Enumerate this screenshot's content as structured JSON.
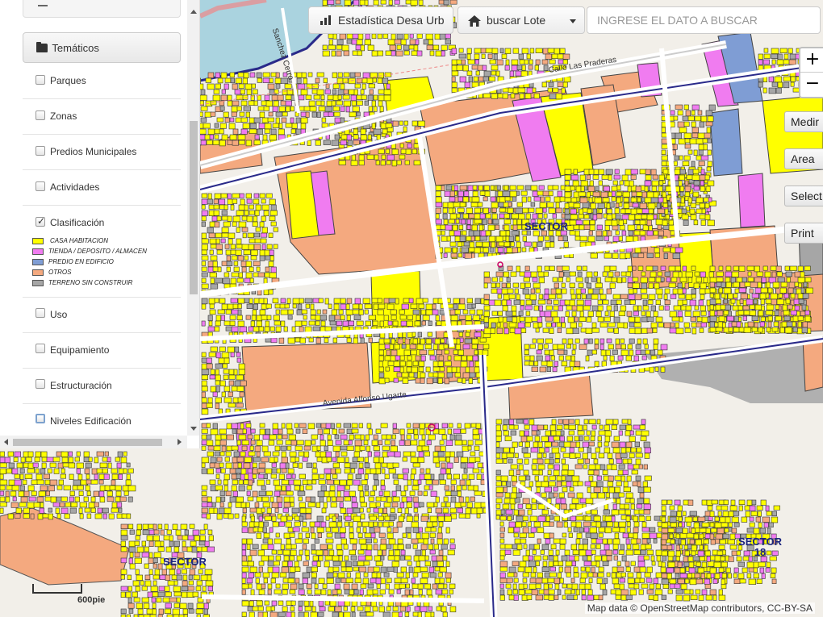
{
  "toolbar": {
    "stats_label": "Estadística Desa Urb",
    "search_lote_label": "buscar Lote",
    "search_placeholder": "INGRESE EL DATO A BUSCAR"
  },
  "sidebar": {
    "group_label": "Temáticos",
    "layers": [
      {
        "label": "Parques",
        "checked": false
      },
      {
        "label": "Zonas",
        "checked": false
      },
      {
        "label": "Predios Municipales",
        "checked": false
      },
      {
        "label": "Actividades",
        "checked": false
      },
      {
        "label": "Clasificación",
        "checked": true
      },
      {
        "label": "Uso",
        "checked": false
      },
      {
        "label": "Equipamiento",
        "checked": false
      },
      {
        "label": "Estructuración",
        "checked": false
      },
      {
        "label": "Niveles Edificación",
        "checked": false
      }
    ],
    "legend": [
      {
        "label": "CASA HABITACION",
        "color": "#ffff00"
      },
      {
        "label": "TIENDA / DEPOSITO / ALMACEN",
        "color": "#f07cf0"
      },
      {
        "label": "PREDIO EN EDIFICIO",
        "color": "#7f9dd4"
      },
      {
        "label": "OTROS",
        "color": "#f4a97f"
      },
      {
        "label": "TERRENO SIN CONSTRUIR",
        "color": "#a6a6a6"
      }
    ]
  },
  "map_controls": {
    "zoom_in": "+",
    "zoom_out": "−",
    "measure": "Medir",
    "area": "Area",
    "select": "Select",
    "print": "Print"
  },
  "map": {
    "sectors": [
      {
        "label": "SECTOR"
      },
      {
        "label": "SECTOR\n18"
      },
      {
        "label": "SECTOR"
      }
    ],
    "roads": [
      {
        "label": "Calle Las Praderas"
      },
      {
        "label": "Sanchez Cerro"
      },
      {
        "label": "Avenida Alfonso Ugarte"
      }
    ],
    "scale_label": "600pie",
    "attribution": "Map data © OpenStreetMap contributors, CC-BY-SA"
  }
}
